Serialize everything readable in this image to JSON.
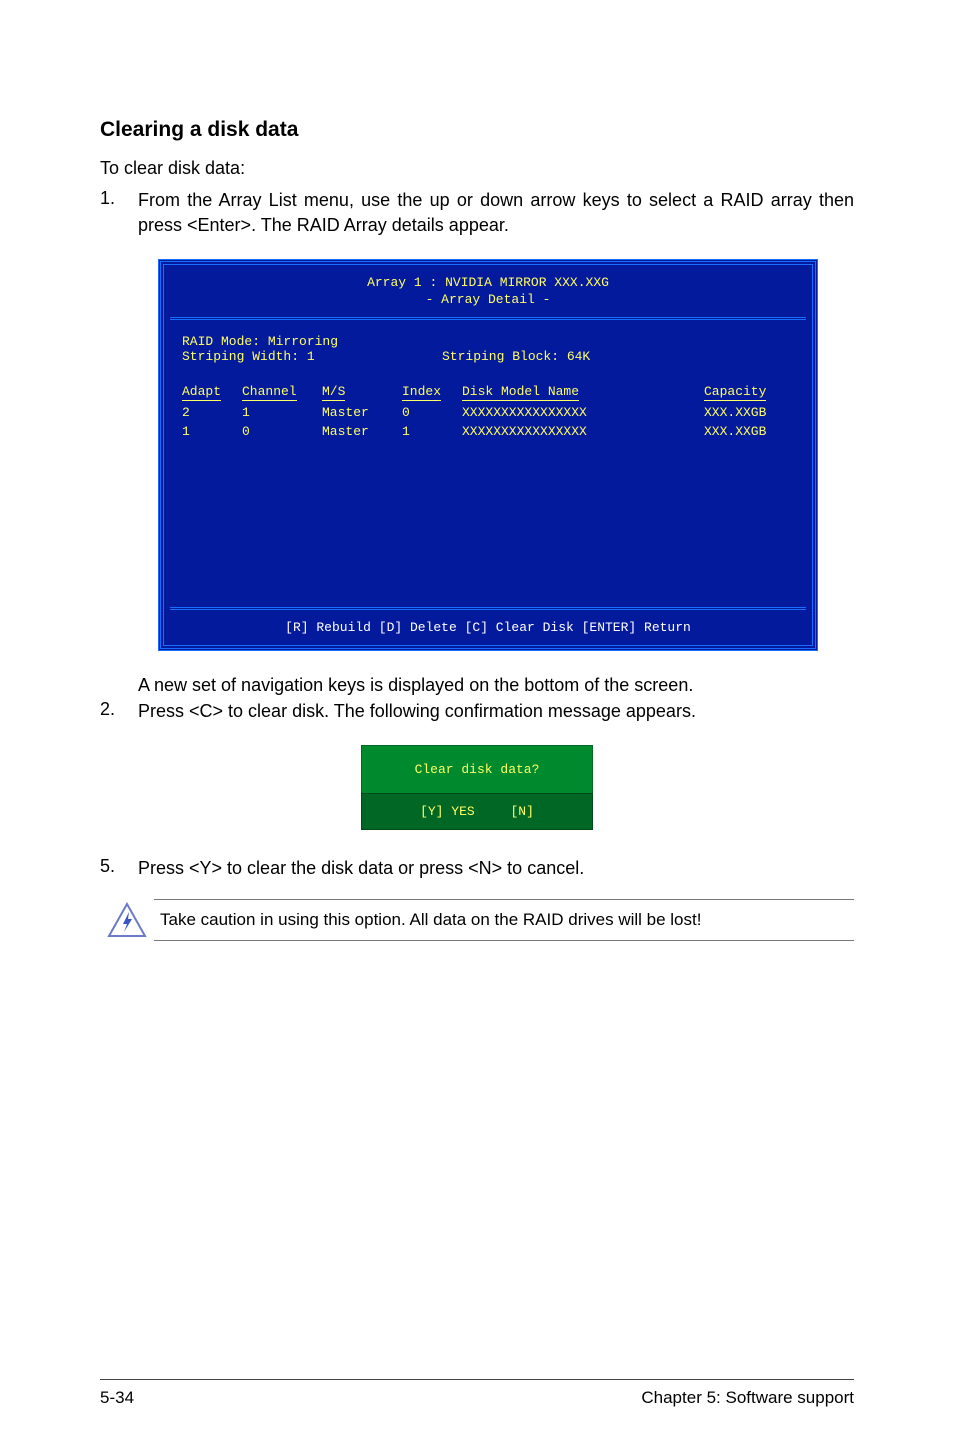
{
  "heading": "Clearing a disk data",
  "intro": "To clear disk data:",
  "step1_num": "1.",
  "step1_body": "From the Array List menu, use the up or down arrow keys to select a RAID array then press <Enter>. The RAID Array details appear.",
  "bios": {
    "title_line1": "Array 1 : NVIDIA MIRROR  XXX.XXG",
    "title_line2": "- Array Detail -",
    "mode_lbl": "RAID Mode: Mirroring",
    "width_lbl": "Striping Width: 1",
    "block_lbl": "Striping Block: 64K",
    "cols": {
      "adapt": "Adapt",
      "channel": "Channel",
      "ms": "M/S",
      "index": "Index",
      "model": "Disk Model Name",
      "capacity": "Capacity"
    },
    "rows": [
      {
        "adapt": "2",
        "channel": "1",
        "ms": "Master",
        "index": "0",
        "model": "XXXXXXXXXXXXXXXX",
        "capacity": "XXX.XXGB"
      },
      {
        "adapt": "1",
        "channel": "0",
        "ms": "Master",
        "index": "1",
        "model": "XXXXXXXXXXXXXXXX",
        "capacity": "XXX.XXGB"
      }
    ],
    "footer": "[R] Rebuild  [D] Delete  [C] Clear Disk  [ENTER] Return"
  },
  "after1": "A new set of  navigation keys is displayed on the bottom of the screen.",
  "step2_num": "2.",
  "step2_body": "Press <C> to clear disk. The following confirmation message appears.",
  "dialog": {
    "title": "Clear disk data?",
    "yes": "[Y] YES",
    "no": "[N]"
  },
  "step5_num": "5.",
  "step5_body": "Press <Y> to clear the disk data or press <N> to cancel.",
  "caution": "Take caution in using this option. All data on the RAID drives will be lost!",
  "footer_left": "5-34",
  "footer_right": "Chapter 5: Software support"
}
